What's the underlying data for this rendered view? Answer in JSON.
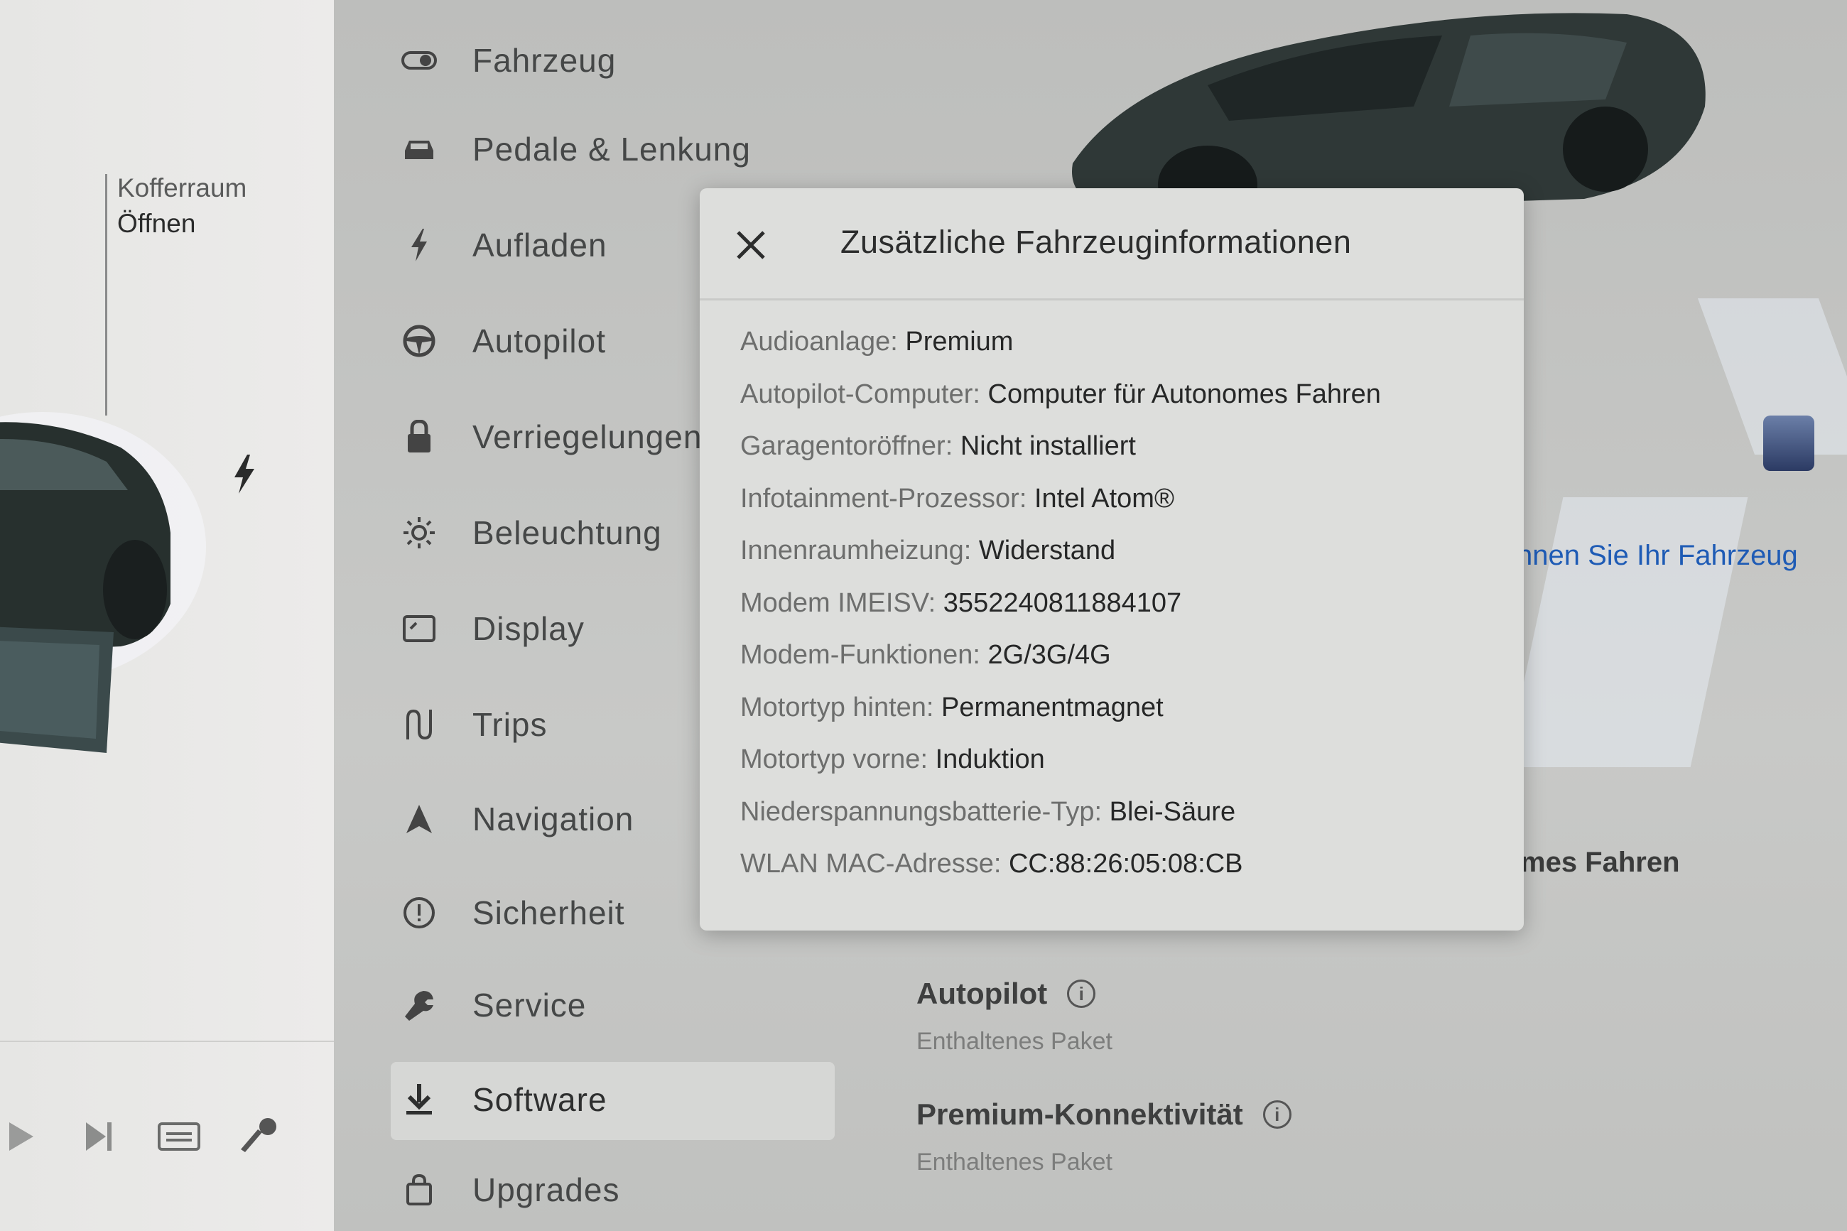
{
  "left_panel": {
    "trunk_label": "Kofferraum",
    "trunk_action": "Öffnen"
  },
  "nav": {
    "items": [
      {
        "label": "Fahrzeug",
        "icon": "toggle-icon"
      },
      {
        "label": "Pedale & Lenkung",
        "icon": "car-icon"
      },
      {
        "label": "Aufladen",
        "icon": "bolt-icon"
      },
      {
        "label": "Autopilot",
        "icon": "steering-wheel-icon"
      },
      {
        "label": "Verriegelungen",
        "icon": "lock-icon"
      },
      {
        "label": "Beleuchtung",
        "icon": "sun-icon"
      },
      {
        "label": "Display",
        "icon": "display-icon"
      },
      {
        "label": "Trips",
        "icon": "trips-icon"
      },
      {
        "label": "Navigation",
        "icon": "navigation-arrow-icon"
      },
      {
        "label": "Sicherheit",
        "icon": "alert-circle-icon"
      },
      {
        "label": "Service",
        "icon": "wrench-icon"
      },
      {
        "label": "Software",
        "icon": "download-icon"
      },
      {
        "label": "Upgrades",
        "icon": "shopping-bag-icon"
      }
    ],
    "active": "Software"
  },
  "background": {
    "link_text": "nnen Sie Ihr Fahrzeug",
    "peek_text": "mes Fahren",
    "sections": [
      {
        "title": "Autopilot",
        "subtitle": "Enthaltenes Paket"
      },
      {
        "title": "Premium-Konnektivität",
        "subtitle": "Enthaltenes Paket"
      }
    ]
  },
  "modal": {
    "title": "Zusätzliche Fahrzeuginformationen",
    "rows": [
      {
        "key": "Audioanlage:",
        "value": "Premium"
      },
      {
        "key": "Autopilot-Computer:",
        "value": "Computer für Autonomes Fahren"
      },
      {
        "key": "Garagentoröffner:",
        "value": "Nicht installiert"
      },
      {
        "key": "Infotainment-Prozessor:",
        "value": "Intel Atom®"
      },
      {
        "key": "Innenraumheizung:",
        "value": "Widerstand"
      },
      {
        "key": "Modem IMEISV:",
        "value": "3552240811884107"
      },
      {
        "key": "Modem-Funktionen:",
        "value": "2G/3G/4G"
      },
      {
        "key": "Motortyp hinten:",
        "value": "Permanentmagnet"
      },
      {
        "key": "Motortyp vorne:",
        "value": "Induktion"
      },
      {
        "key": "Niederspannungsbatterie-Typ:",
        "value": "Blei-Säure"
      },
      {
        "key": "WLAN MAC-Adresse:",
        "value": "CC:88:26:05:08:CB"
      }
    ]
  },
  "colors": {
    "accent_link": "#1e5bb5",
    "modal_bg": "#dddedc",
    "panel_bg": "#c4c5c3"
  }
}
